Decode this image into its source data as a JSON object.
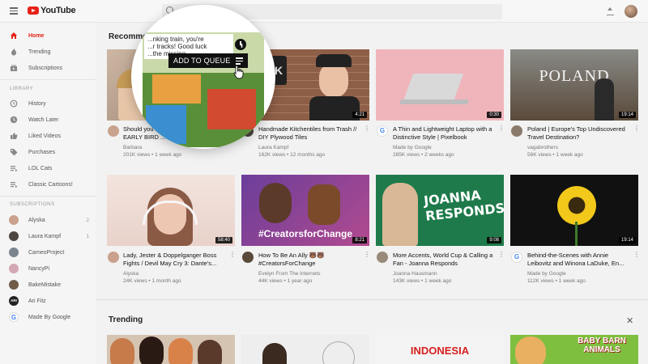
{
  "app": {
    "logo_text": "YouTube"
  },
  "header": {
    "search_placeholder": ""
  },
  "sidebar": {
    "main": [
      {
        "label": "Home",
        "icon": "home-icon"
      },
      {
        "label": "Trending",
        "icon": "flame-icon"
      },
      {
        "label": "Subscriptions",
        "icon": "subscriptions-icon"
      }
    ],
    "library_heading": "LIBRARY",
    "library": [
      {
        "label": "History",
        "icon": "history-icon"
      },
      {
        "label": "Watch Later",
        "icon": "clock-icon"
      },
      {
        "label": "Liked Videos",
        "icon": "thumbs-up-icon"
      },
      {
        "label": "Purchases",
        "icon": "tag-icon"
      },
      {
        "label": "LOL Cats",
        "icon": "playlist-icon"
      },
      {
        "label": "Classic Cartoons!",
        "icon": "playlist-icon"
      }
    ],
    "subscriptions_heading": "SUBSCRIPTIONS",
    "subscriptions": [
      {
        "label": "Alyska",
        "count": "2",
        "color": "#caa18c"
      },
      {
        "label": "Laura Kampf",
        "count": "1",
        "color": "#4d4640"
      },
      {
        "label": "CameoProject",
        "count": "",
        "color": "#7a8590"
      },
      {
        "label": "NancyPi",
        "count": "",
        "color": "#d3a7b3"
      },
      {
        "label": "BakeMistake",
        "count": "",
        "color": "#6f5b48"
      },
      {
        "label": "Ari Fitz",
        "count": "",
        "color": "#222222",
        "initials": "ARI"
      },
      {
        "label": "Made By Google",
        "count": "",
        "color": "#ffffff",
        "initials": "G"
      }
    ]
  },
  "recommended": {
    "title": "Recommended",
    "videos": [
      {
        "title": "Should you buy a used ... World?? | EARLY BIRD ...",
        "channel": "Barbara",
        "meta": "201K views • 1 week ago",
        "duration": "",
        "avatar": "#c9a38e"
      },
      {
        "title": "Handmade Kitchentiles from Trash // DIY Plywood Tiles",
        "channel": "Laura Kampf",
        "meta": "162K views • 12 months ago",
        "duration": "4:21",
        "avatar": "#4d4640"
      },
      {
        "title": "A Thin and Lightweight Laptop with a Distinctive Style | Pixelbook",
        "channel": "Made by Google",
        "meta": "285K views • 2 weeks ago",
        "duration": "0:30",
        "avatar": "#ffffff"
      },
      {
        "title": "Poland | Europe's Top Undiscovered Travel Destination?",
        "channel": "vagabrothers",
        "meta": "56K views • 1 week ago",
        "duration": "19:14",
        "avatar": "#8a7a6a"
      },
      {
        "title": "Lady, Jester & Doppelganger Boss Fights / Devil May Cry 3: Dante's...",
        "channel": "Alyska",
        "meta": "24K views • 1 month ago",
        "duration": "58:40",
        "avatar": "#caa18c"
      },
      {
        "title": "How To Be An Ally 🐻🐻 #CreatorsForChange",
        "channel": "Evelyn From The Internets",
        "meta": "44K views • 1 year ago",
        "duration": "8:21",
        "avatar": "#5a4a3a"
      },
      {
        "title": "More Accents, World Cup & Calling a Fan - Joanna Responds",
        "channel": "Joanna Hausmann",
        "meta": "143K views • 1 week ago",
        "duration": "9:08",
        "avatar": "#9a8a7a"
      },
      {
        "title": "Behind-the-Scenes with Annie Leibovitz and Winona LaDuke, En...",
        "channel": "Made by Google",
        "meta": "112K views • 1 week ago",
        "duration": "19:14",
        "avatar": "#ffffff"
      }
    ]
  },
  "trending": {
    "title": "Trending"
  },
  "magnifier": {
    "overlay_text_1": "...nking train, you're",
    "overlay_text_2": "...r tracks! Good luck",
    "overlay_text_3": "...the missing",
    "queue_label": "ADD TO QUEUE"
  },
  "thumb_texts": {
    "kitchen_sign": "K",
    "poland": "POLAND",
    "creators": "#CreatorsforChange",
    "joanna": "JOANNA RESPONDS!",
    "indonesia": "INDONESIA",
    "baby_barn": "BABY BARN ANIMALS"
  }
}
